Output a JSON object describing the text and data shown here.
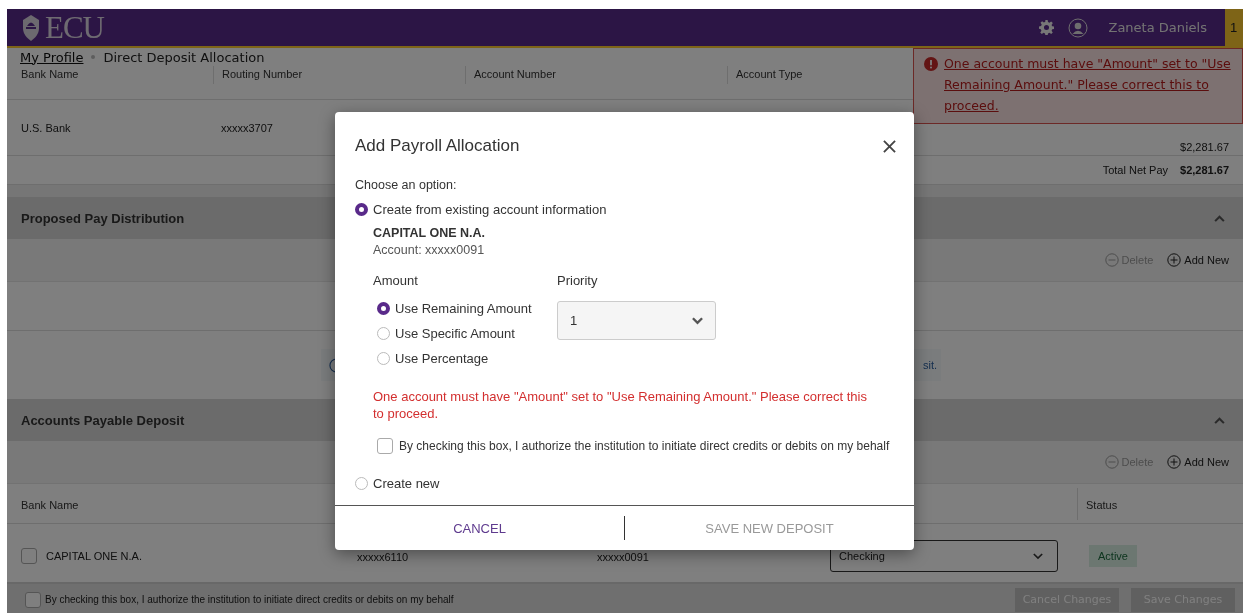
{
  "header": {
    "logo": "ECU",
    "user": "Zaneta Daniels",
    "badge": "1"
  },
  "breadcrumb": {
    "parent": "My Profile",
    "current": "Direct Deposit Allocation"
  },
  "toast": {
    "message": "One account must have \"Amount\" set to \"Use Remaining Amount.\" Please correct this to proceed."
  },
  "current_pay": {
    "columns": [
      "Bank Name",
      "Routing Number",
      "Account Number",
      "Account Type"
    ],
    "rows": [
      {
        "bank": "U.S. Bank",
        "routing": "xxxxx3707",
        "amount": "$2,281.67"
      }
    ],
    "total_label": "Total Net Pay",
    "total": "$2,281.67"
  },
  "proposed": {
    "title": "Proposed Pay Distribution",
    "expanded": true,
    "actions": [
      {
        "kind": "delete",
        "label": "Delete",
        "disabled": true
      },
      {
        "kind": "add",
        "label": "Add New",
        "disabled": false
      }
    ],
    "info_text": "sit."
  },
  "payable": {
    "title": "Accounts Payable Deposit",
    "expanded": true,
    "actions": [
      {
        "kind": "delete",
        "label": "Delete",
        "disabled": true
      },
      {
        "kind": "add",
        "label": "Add New",
        "disabled": false
      }
    ],
    "columns": [
      "Bank Name",
      "Status"
    ],
    "rows": [
      {
        "checked": false,
        "bank": "CAPITAL ONE N.A.",
        "routing": "xxxxx6110",
        "account": "xxxxx0091",
        "type": "Checking",
        "status": "Active"
      }
    ]
  },
  "footer": {
    "consent": {
      "label": "By checking this box, I authorize the institution to initiate direct credits or debits on my behalf",
      "checked": false
    },
    "buttons": [
      {
        "label": "Cancel Changes",
        "disabled": true
      },
      {
        "label": "Save Changes",
        "disabled": true
      }
    ]
  },
  "modal": {
    "title": "Add Payroll Allocation",
    "prompt": "Choose an option:",
    "options": [
      {
        "kind": "existing",
        "label": "Create from existing account information",
        "selected": true
      },
      {
        "kind": "new",
        "label": "Create new",
        "selected": false
      }
    ],
    "account": {
      "bank": "CAPITAL ONE N.A.",
      "number": "Account: xxxxx0091"
    },
    "amount_label": "Amount",
    "amount_options": [
      {
        "label": "Use Remaining Amount",
        "selected": true
      },
      {
        "label": "Use Specific Amount",
        "selected": false
      },
      {
        "label": "Use Percentage",
        "selected": false
      }
    ],
    "priority_label": "Priority",
    "priority": "1",
    "error": "One account must have \"Amount\" set to \"Use Remaining Amount.\" Please correct this to proceed.",
    "consent": {
      "label": "By checking this box, I authorize the institution to initiate direct credits or debits on my behalf",
      "checked": false
    },
    "buttons": [
      {
        "label": "CANCEL",
        "disabled": false
      },
      {
        "label": "SAVE NEW DEPOSIT",
        "disabled": true
      }
    ]
  }
}
